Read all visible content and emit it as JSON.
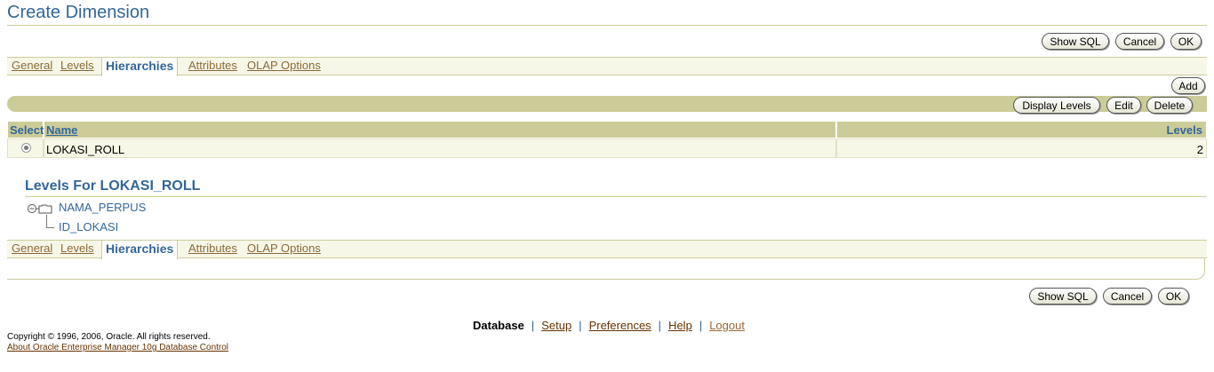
{
  "page": {
    "title": "Create Dimension"
  },
  "top_buttons": {
    "show_sql": "Show SQL",
    "cancel": "Cancel",
    "ok": "OK"
  },
  "tabs": [
    {
      "label": "General"
    },
    {
      "label": "Levels"
    },
    {
      "label": "Hierarchies"
    },
    {
      "label": "Attributes"
    },
    {
      "label": "OLAP Options"
    }
  ],
  "actions": {
    "add": "Add",
    "display_levels": "Display Levels",
    "edit": "Edit",
    "delete": "Delete"
  },
  "table": {
    "headers": {
      "select": "Select",
      "name": "Name",
      "levels": "Levels"
    },
    "rows": [
      {
        "name": "LOKASI_ROLL",
        "levels": "2",
        "selected": true
      }
    ]
  },
  "levels_section": {
    "title": "Levels For LOKASI_ROLL",
    "tree": [
      {
        "label": "NAMA_PERPUS"
      },
      {
        "label": "ID_LOKASI"
      }
    ]
  },
  "bottom_buttons": {
    "show_sql": "Show SQL",
    "cancel": "Cancel",
    "ok": "OK"
  },
  "footer": {
    "links": [
      "Database",
      "Setup",
      "Preferences",
      "Help",
      "Logout"
    ],
    "copyright": "Copyright © 1996, 2006, Oracle. All rights reserved.",
    "about": "About Oracle Enterprise Manager 10g Database Control"
  },
  "colors": {
    "accent": "#336699",
    "band": "#cccc99",
    "light_band": "#f7f7e7",
    "link": "#663300"
  }
}
